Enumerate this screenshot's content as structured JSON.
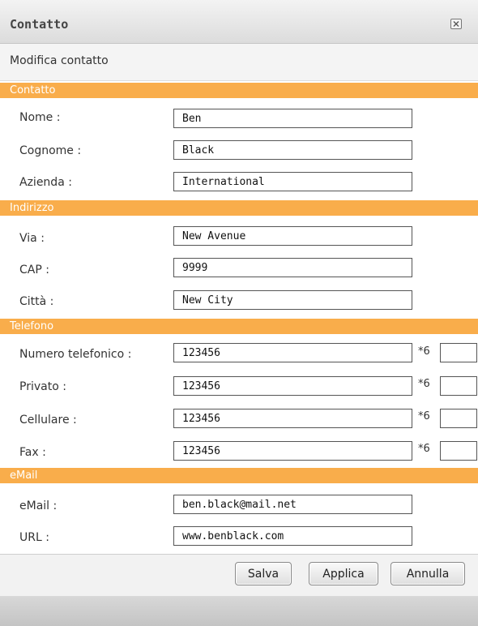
{
  "window": {
    "title": "Contatto"
  },
  "subheader": "Modifica contatto",
  "sections": {
    "contatto": "Contatto",
    "indirizzo": "Indirizzo",
    "telefono": "Telefono",
    "email": "eMail"
  },
  "fields": {
    "nome": {
      "label": "Nome :",
      "value": "Ben"
    },
    "cognome": {
      "label": "Cognome :",
      "value": "Black"
    },
    "azienda": {
      "label": "Azienda :",
      "value": "International"
    },
    "via": {
      "label": "Via :",
      "value": "New Avenue"
    },
    "cap": {
      "label": "CAP :",
      "value": "9999"
    },
    "citta": {
      "label": "Città :",
      "value": "New City"
    },
    "numero_telefonico": {
      "label": "Numero telefonico :",
      "value": "123456",
      "prefix": "*6"
    },
    "privato": {
      "label": "Privato :",
      "value": "123456",
      "prefix": "*6"
    },
    "cellulare": {
      "label": "Cellulare :",
      "value": "123456",
      "prefix": "*6"
    },
    "fax": {
      "label": "Fax :",
      "value": "123456",
      "prefix": "*6"
    },
    "email": {
      "label": "eMail :",
      "value": "ben.black@mail.net"
    },
    "url": {
      "label": "URL :",
      "value": "www.benblack.com"
    }
  },
  "buttons": {
    "salva": "Salva",
    "applica": "Applica",
    "annulla": "Annulla"
  },
  "icons": {
    "close": "close-icon"
  },
  "colors": {
    "section_header": "#f9ad4b",
    "titlebar": "#e6e6e6"
  }
}
